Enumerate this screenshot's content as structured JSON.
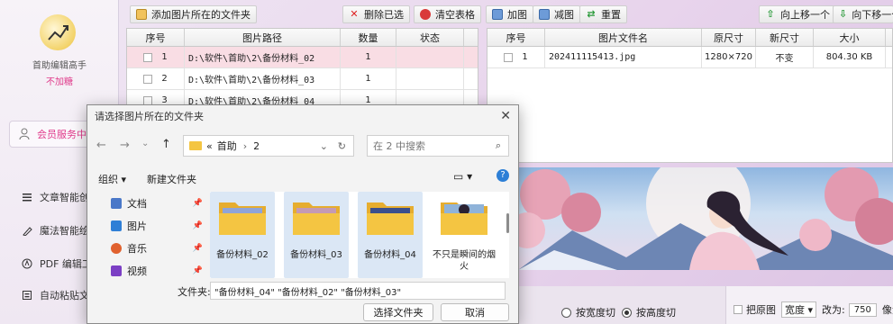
{
  "sidebar": {
    "app_name": "首助编辑高手",
    "vip_status": "不加糖",
    "member_button": "会员服务中…",
    "nav": [
      {
        "label": "文章智能创作"
      },
      {
        "label": "魔法智能绘图"
      },
      {
        "label": "PDF 编辑工具"
      },
      {
        "label": "自动粘贴文本"
      }
    ]
  },
  "toolbar": {
    "add_folder": "添加图片所在的文件夹",
    "delete_selected": "删除已选",
    "clear_table": "清空表格",
    "add_image": "加图",
    "remove_image": "减图",
    "reset": "重置",
    "move_up": "向上移一个",
    "move_down": "向下移一个"
  },
  "left_table": {
    "headers": [
      "序号",
      "图片路径",
      "数量",
      "状态"
    ],
    "rows": [
      {
        "num": "1",
        "path": "D:\\软件\\首助\\2\\备份材料_02",
        "count": "1",
        "status": ""
      },
      {
        "num": "2",
        "path": "D:\\软件\\首助\\2\\备份材料_03",
        "count": "1",
        "status": ""
      },
      {
        "num": "3",
        "path": "D:\\软件\\首助\\2\\备份材料_04",
        "count": "1",
        "status": ""
      }
    ]
  },
  "right_table": {
    "headers": [
      "序号",
      "图片文件名",
      "原尺寸",
      "新尺寸",
      "大小"
    ],
    "rows": [
      {
        "num": "1",
        "name": "202411115413.jpg",
        "orig": "1280×720",
        "new": "不变",
        "size": "804.30 KB"
      }
    ]
  },
  "options": {
    "width_cut": "按宽度切",
    "height_cut": "按高度切",
    "selected": "height_cut",
    "original_checkbox": "把原图",
    "dim_select": "宽度",
    "change_to_label": "改为:",
    "change_to_value": "750",
    "unit": "像素"
  },
  "dialog": {
    "title": "请选择图片所在的文件夹",
    "breadcrumb_prefix": "«",
    "breadcrumb": [
      "首助",
      "2"
    ],
    "search_placeholder": "在 2 中搜索",
    "organize": "组织 ▾",
    "new_folder": "新建文件夹",
    "nav_items": [
      {
        "label": "文档",
        "icon": "document-icon",
        "color": "#4a78c8"
      },
      {
        "label": "图片",
        "icon": "picture-icon",
        "color": "#2f7fd6"
      },
      {
        "label": "音乐",
        "icon": "music-icon",
        "color": "#e0612e"
      },
      {
        "label": "视频",
        "icon": "video-icon",
        "color": "#7b3fc4"
      }
    ],
    "folders": [
      {
        "name": "备份材料_02",
        "selected": true
      },
      {
        "name": "备份材料_03",
        "selected": true
      },
      {
        "name": "备份材料_04",
        "selected": true
      },
      {
        "name": "不只是瞬间的烟火",
        "selected": false
      }
    ],
    "folder_label": "文件夹:",
    "folder_value": "\"备份材料_04\" \"备份材料_02\" \"备份材料_03\"",
    "select_button": "选择文件夹",
    "cancel_button": "取消"
  },
  "colors": {
    "accent": "#e03a8a",
    "selection": "#dbe7f5",
    "folder": "#f4c542"
  }
}
